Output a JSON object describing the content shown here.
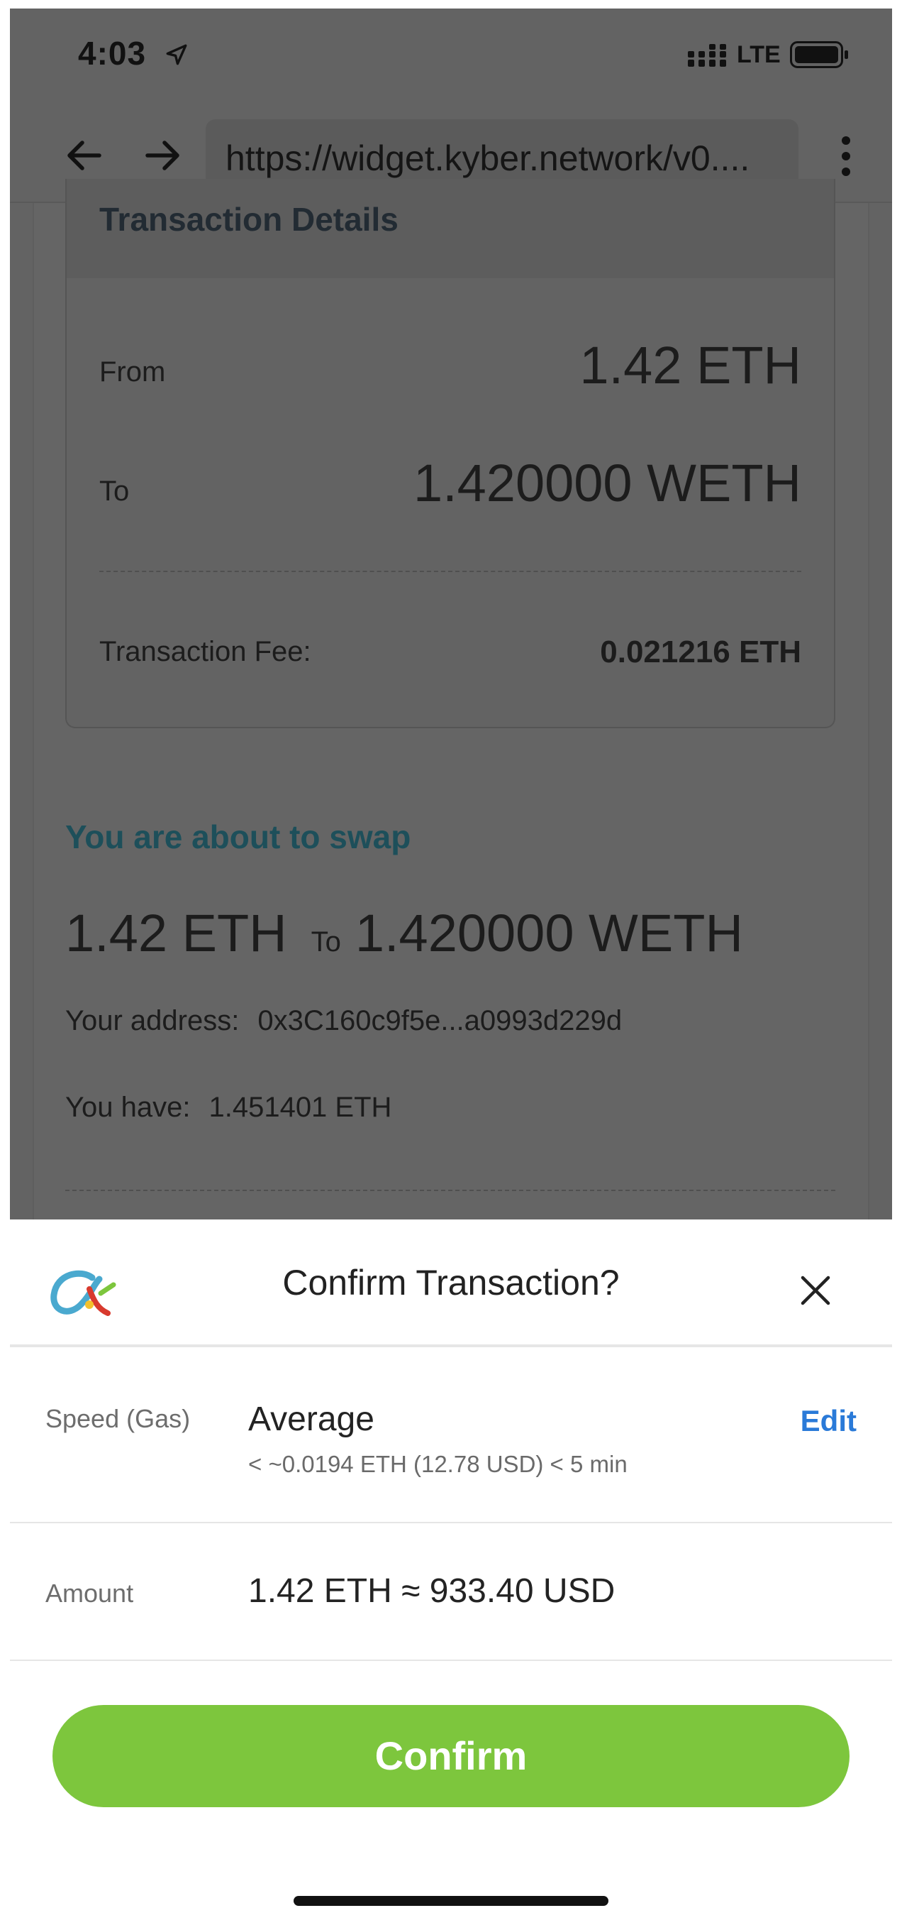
{
  "status_bar": {
    "time": "4:03",
    "network": "LTE"
  },
  "browser": {
    "url": "https://widget.kyber.network/v0...."
  },
  "transaction_details": {
    "title": "Transaction Details",
    "from_label": "From",
    "from_value": "1.42 ETH",
    "to_label": "To",
    "to_value": "1.420000 WETH",
    "fee_label": "Transaction Fee:",
    "fee_value": "0.021216 ETH"
  },
  "swap": {
    "title": "You are about to swap",
    "from_amount": "1.42 ETH",
    "to_word": "To",
    "to_amount": "1.420000 WETH",
    "address_label": "Your address:",
    "address_value": "0x3C160c9f5e...a0993d229d",
    "balance_label": "You have:",
    "balance_value": "1.451401 ETH"
  },
  "confirm_sheet": {
    "title": "Confirm Transaction?",
    "speed_label": "Speed (Gas)",
    "speed_value": "Average",
    "speed_detail": "< ~0.0194 ETH (12.78 USD) < 5 min",
    "edit_label": "Edit",
    "amount_label": "Amount",
    "amount_value": "1.42 ETH ≈ 933.40 USD",
    "confirm_label": "Confirm"
  },
  "icons": [
    "location-arrow-icon",
    "signal-icon",
    "battery-icon",
    "back-arrow-icon",
    "forward-arrow-icon",
    "more-vertical-icon",
    "wallet-logo-icon",
    "close-icon"
  ],
  "colors": {
    "overlay": "#636363",
    "accent_teal": "#1d4f5a",
    "edit_blue": "#2a7ad8",
    "confirm_green": "#7dc63d"
  }
}
